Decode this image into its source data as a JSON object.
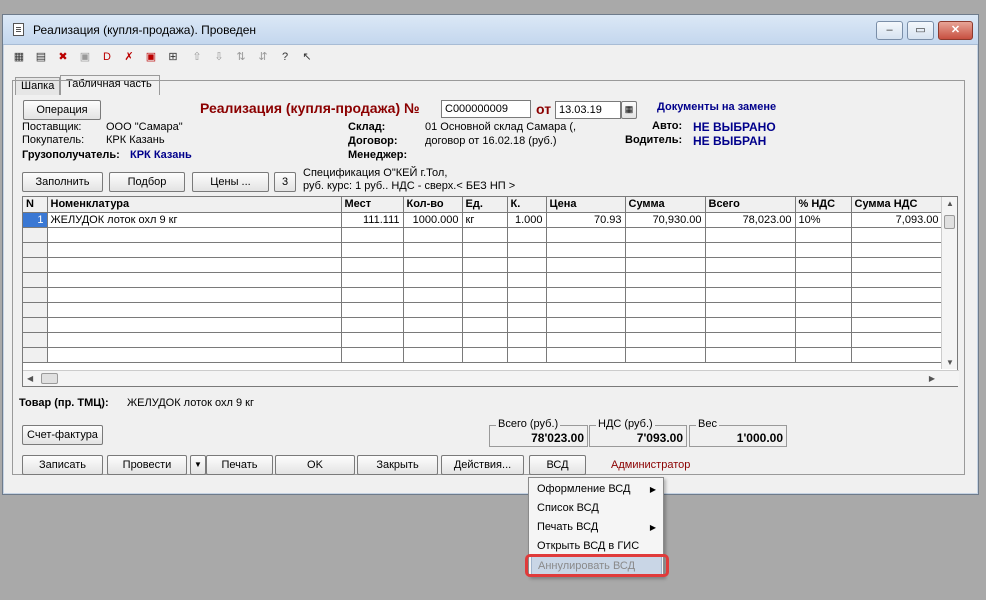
{
  "window": {
    "title": "Реализация (купля-продажа). Проведен"
  },
  "tabs": [
    "Шапка",
    "Табличная часть"
  ],
  "header": {
    "operation_button": "Операция",
    "doc_title": "Реализация (купля-продажа) №",
    "doc_number": "С000000009",
    "date_prefix": "от",
    "date": "13.03.19",
    "replacement_docs": "Документы на замене",
    "supplier_label": "Поставщик:",
    "supplier_value": "ООО \"Самара\"",
    "buyer_label": "Покупатель:",
    "buyer_value": "КРК Казань",
    "consignee_label": "Грузополучатель:",
    "consignee_value": "КРК Казань",
    "warehouse_label": "Склад:",
    "warehouse_value": "01 Основной склад Самара (,",
    "contract_label": "Договор:",
    "contract_value": "договор от 16.02.18 (руб.)",
    "manager_label": "Менеджер:",
    "auto_label": "Авто:",
    "auto_value": "НЕ ВЫБРАНО",
    "driver_label": "Водитель:",
    "driver_value": "НЕ ВЫБРАН"
  },
  "grid_toolbar": {
    "fill": "Заполнить",
    "selection": "Подбор",
    "prices": "Цены ...",
    "count": "3",
    "spec_line1": "Спецификация О\"КЕЙ г.Тол,",
    "spec_line2": "руб. курс: 1 руб.. НДС - сверх.< БЕЗ НП >"
  },
  "table": {
    "columns": [
      "N",
      "Номенклатура",
      "Мест",
      "Кол-во",
      "Ед.",
      "К.",
      "Цена",
      "Сумма",
      "Всего",
      "% НДС",
      "Сумма НДС"
    ],
    "rows": [
      [
        "1",
        "ЖЕЛУДОК лоток охл 9 кг",
        "111.111",
        "1000.000",
        "кг",
        "1.000",
        "70.93",
        "70,930.00",
        "78,023.00",
        "10%",
        "7,093.00"
      ]
    ]
  },
  "product": {
    "label": "Товар (пр. ТМЦ):",
    "value": "ЖЕЛУДОК лоток охл 9 кг"
  },
  "totals": {
    "total_label": "Всего (руб.)",
    "total_value": "78'023.00",
    "vat_label": "НДС (руб.)",
    "vat_value": "7'093.00",
    "weight_label": "Вес",
    "weight_value": "1'000.00"
  },
  "invoice_button": "Счет-фактура",
  "bottom_buttons": {
    "save": "Записать",
    "post": "Провести",
    "print": "Печать",
    "ok": "OK",
    "close": "Закрыть",
    "actions": "Действия...",
    "vsd": "ВСД"
  },
  "user": "Администратор",
  "vsd_menu": [
    {
      "label": "Оформление ВСД",
      "submenu": true
    },
    {
      "label": "Список ВСД",
      "submenu": false
    },
    {
      "label": "Печать ВСД",
      "submenu": true
    },
    {
      "label": "Открыть ВСД в ГИС",
      "submenu": false
    },
    {
      "label": "Аннулировать ВСД",
      "submenu": false
    }
  ],
  "colors": {
    "highlight": "#e03b3b",
    "selection": "#3a78d4",
    "title_red": "#8b0000",
    "value_blue": "#00008b"
  }
}
